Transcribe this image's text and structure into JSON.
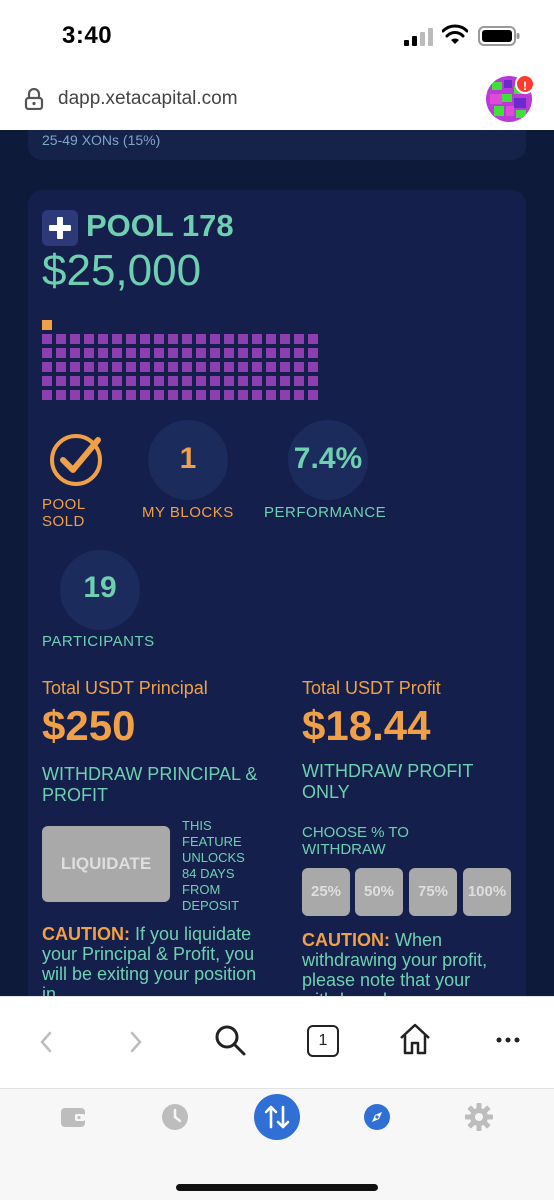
{
  "status_bar": {
    "time": "3:40"
  },
  "browser": {
    "url": "dapp.xetacapital.com",
    "notification_badge": "!"
  },
  "previous_card": {
    "text": "25-49 XONs (15%)"
  },
  "pool": {
    "title": "POOL 178",
    "amount": "$25,000",
    "blocks_total": 100,
    "blocks_owned": 1,
    "status_label": "POOL SOLD",
    "my_blocks_value": "1",
    "my_blocks_label": "MY BLOCKS",
    "performance_value": "7.4%",
    "performance_label": "PERFORMANCE",
    "participants_value": "19",
    "participants_label": "PARTICIPANTS"
  },
  "principal": {
    "title": "Total USDT Principal",
    "value": "$250",
    "subtitle": "WITHDRAW PRINCIPAL & PROFIT",
    "liquidate_label": "LIQUIDATE",
    "feature_note": "THIS FEATURE UNLOCKS 84 DAYS FROM DEPOSIT",
    "caution_label": "CAUTION:",
    "caution_text": "If you liquidate your Principal & Profit, you will be exiting your position in"
  },
  "profit": {
    "title": "Total USDT Profit",
    "value": "$18.44",
    "subtitle": "WITHDRAW PROFIT ONLY",
    "choose_label": "CHOOSE % TO WITHDRAW",
    "percent_options": [
      "25%",
      "50%",
      "75%",
      "100%"
    ],
    "caution_label": "CAUTION:",
    "caution_text": "When withdrawing your profit, please note that your withdrawal"
  },
  "colors": {
    "background": "#0e1a3a",
    "card": "#151f4b",
    "teal": "#6ed0b0",
    "orange": "#f0a046",
    "purple_block": "#8d3fb0",
    "disabled_button": "#a9a9a9",
    "active_nav": "#2f6fd6"
  },
  "toolbar": {
    "tabs_count": "1"
  },
  "bottom_nav": {
    "items": [
      "wallet-icon",
      "history-icon",
      "swap-icon",
      "browser-icon",
      "settings-icon"
    ],
    "active": "swap-icon"
  }
}
